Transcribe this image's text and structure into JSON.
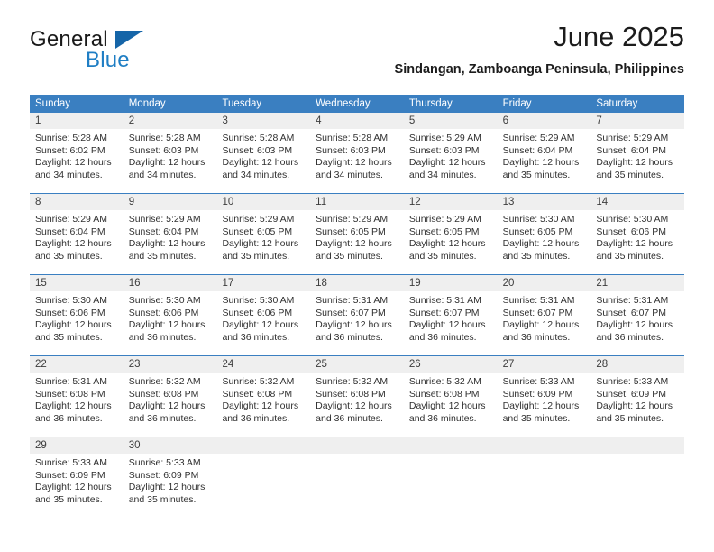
{
  "brand": {
    "name_top": "General",
    "name_bottom": "Blue",
    "triangle_color": "#1565a8",
    "blue_text_color": "#1f7ec4"
  },
  "header": {
    "title": "June 2025",
    "subtitle": "Sindangan, Zamboanga Peninsula, Philippines"
  },
  "colors": {
    "header_band": "#3a7fc1",
    "daynum_band": "#efefef",
    "separator": "#3a7fc1",
    "text": "#303030"
  },
  "weekdays": [
    "Sunday",
    "Monday",
    "Tuesday",
    "Wednesday",
    "Thursday",
    "Friday",
    "Saturday"
  ],
  "weeks": [
    [
      {
        "day": "1",
        "sunrise": "Sunrise: 5:28 AM",
        "sunset": "Sunset: 6:02 PM",
        "daylight_1": "Daylight: 12 hours",
        "daylight_2": "and 34 minutes."
      },
      {
        "day": "2",
        "sunrise": "Sunrise: 5:28 AM",
        "sunset": "Sunset: 6:03 PM",
        "daylight_1": "Daylight: 12 hours",
        "daylight_2": "and 34 minutes."
      },
      {
        "day": "3",
        "sunrise": "Sunrise: 5:28 AM",
        "sunset": "Sunset: 6:03 PM",
        "daylight_1": "Daylight: 12 hours",
        "daylight_2": "and 34 minutes."
      },
      {
        "day": "4",
        "sunrise": "Sunrise: 5:28 AM",
        "sunset": "Sunset: 6:03 PM",
        "daylight_1": "Daylight: 12 hours",
        "daylight_2": "and 34 minutes."
      },
      {
        "day": "5",
        "sunrise": "Sunrise: 5:29 AM",
        "sunset": "Sunset: 6:03 PM",
        "daylight_1": "Daylight: 12 hours",
        "daylight_2": "and 34 minutes."
      },
      {
        "day": "6",
        "sunrise": "Sunrise: 5:29 AM",
        "sunset": "Sunset: 6:04 PM",
        "daylight_1": "Daylight: 12 hours",
        "daylight_2": "and 35 minutes."
      },
      {
        "day": "7",
        "sunrise": "Sunrise: 5:29 AM",
        "sunset": "Sunset: 6:04 PM",
        "daylight_1": "Daylight: 12 hours",
        "daylight_2": "and 35 minutes."
      }
    ],
    [
      {
        "day": "8",
        "sunrise": "Sunrise: 5:29 AM",
        "sunset": "Sunset: 6:04 PM",
        "daylight_1": "Daylight: 12 hours",
        "daylight_2": "and 35 minutes."
      },
      {
        "day": "9",
        "sunrise": "Sunrise: 5:29 AM",
        "sunset": "Sunset: 6:04 PM",
        "daylight_1": "Daylight: 12 hours",
        "daylight_2": "and 35 minutes."
      },
      {
        "day": "10",
        "sunrise": "Sunrise: 5:29 AM",
        "sunset": "Sunset: 6:05 PM",
        "daylight_1": "Daylight: 12 hours",
        "daylight_2": "and 35 minutes."
      },
      {
        "day": "11",
        "sunrise": "Sunrise: 5:29 AM",
        "sunset": "Sunset: 6:05 PM",
        "daylight_1": "Daylight: 12 hours",
        "daylight_2": "and 35 minutes."
      },
      {
        "day": "12",
        "sunrise": "Sunrise: 5:29 AM",
        "sunset": "Sunset: 6:05 PM",
        "daylight_1": "Daylight: 12 hours",
        "daylight_2": "and 35 minutes."
      },
      {
        "day": "13",
        "sunrise": "Sunrise: 5:30 AM",
        "sunset": "Sunset: 6:05 PM",
        "daylight_1": "Daylight: 12 hours",
        "daylight_2": "and 35 minutes."
      },
      {
        "day": "14",
        "sunrise": "Sunrise: 5:30 AM",
        "sunset": "Sunset: 6:06 PM",
        "daylight_1": "Daylight: 12 hours",
        "daylight_2": "and 35 minutes."
      }
    ],
    [
      {
        "day": "15",
        "sunrise": "Sunrise: 5:30 AM",
        "sunset": "Sunset: 6:06 PM",
        "daylight_1": "Daylight: 12 hours",
        "daylight_2": "and 35 minutes."
      },
      {
        "day": "16",
        "sunrise": "Sunrise: 5:30 AM",
        "sunset": "Sunset: 6:06 PM",
        "daylight_1": "Daylight: 12 hours",
        "daylight_2": "and 36 minutes."
      },
      {
        "day": "17",
        "sunrise": "Sunrise: 5:30 AM",
        "sunset": "Sunset: 6:06 PM",
        "daylight_1": "Daylight: 12 hours",
        "daylight_2": "and 36 minutes."
      },
      {
        "day": "18",
        "sunrise": "Sunrise: 5:31 AM",
        "sunset": "Sunset: 6:07 PM",
        "daylight_1": "Daylight: 12 hours",
        "daylight_2": "and 36 minutes."
      },
      {
        "day": "19",
        "sunrise": "Sunrise: 5:31 AM",
        "sunset": "Sunset: 6:07 PM",
        "daylight_1": "Daylight: 12 hours",
        "daylight_2": "and 36 minutes."
      },
      {
        "day": "20",
        "sunrise": "Sunrise: 5:31 AM",
        "sunset": "Sunset: 6:07 PM",
        "daylight_1": "Daylight: 12 hours",
        "daylight_2": "and 36 minutes."
      },
      {
        "day": "21",
        "sunrise": "Sunrise: 5:31 AM",
        "sunset": "Sunset: 6:07 PM",
        "daylight_1": "Daylight: 12 hours",
        "daylight_2": "and 36 minutes."
      }
    ],
    [
      {
        "day": "22",
        "sunrise": "Sunrise: 5:31 AM",
        "sunset": "Sunset: 6:08 PM",
        "daylight_1": "Daylight: 12 hours",
        "daylight_2": "and 36 minutes."
      },
      {
        "day": "23",
        "sunrise": "Sunrise: 5:32 AM",
        "sunset": "Sunset: 6:08 PM",
        "daylight_1": "Daylight: 12 hours",
        "daylight_2": "and 36 minutes."
      },
      {
        "day": "24",
        "sunrise": "Sunrise: 5:32 AM",
        "sunset": "Sunset: 6:08 PM",
        "daylight_1": "Daylight: 12 hours",
        "daylight_2": "and 36 minutes."
      },
      {
        "day": "25",
        "sunrise": "Sunrise: 5:32 AM",
        "sunset": "Sunset: 6:08 PM",
        "daylight_1": "Daylight: 12 hours",
        "daylight_2": "and 36 minutes."
      },
      {
        "day": "26",
        "sunrise": "Sunrise: 5:32 AM",
        "sunset": "Sunset: 6:08 PM",
        "daylight_1": "Daylight: 12 hours",
        "daylight_2": "and 36 minutes."
      },
      {
        "day": "27",
        "sunrise": "Sunrise: 5:33 AM",
        "sunset": "Sunset: 6:09 PM",
        "daylight_1": "Daylight: 12 hours",
        "daylight_2": "and 35 minutes."
      },
      {
        "day": "28",
        "sunrise": "Sunrise: 5:33 AM",
        "sunset": "Sunset: 6:09 PM",
        "daylight_1": "Daylight: 12 hours",
        "daylight_2": "and 35 minutes."
      }
    ],
    [
      {
        "day": "29",
        "sunrise": "Sunrise: 5:33 AM",
        "sunset": "Sunset: 6:09 PM",
        "daylight_1": "Daylight: 12 hours",
        "daylight_2": "and 35 minutes."
      },
      {
        "day": "30",
        "sunrise": "Sunrise: 5:33 AM",
        "sunset": "Sunset: 6:09 PM",
        "daylight_1": "Daylight: 12 hours",
        "daylight_2": "and 35 minutes."
      },
      {
        "day": "",
        "sunrise": "",
        "sunset": "",
        "daylight_1": "",
        "daylight_2": ""
      },
      {
        "day": "",
        "sunrise": "",
        "sunset": "",
        "daylight_1": "",
        "daylight_2": ""
      },
      {
        "day": "",
        "sunrise": "",
        "sunset": "",
        "daylight_1": "",
        "daylight_2": ""
      },
      {
        "day": "",
        "sunrise": "",
        "sunset": "",
        "daylight_1": "",
        "daylight_2": ""
      },
      {
        "day": "",
        "sunrise": "",
        "sunset": "",
        "daylight_1": "",
        "daylight_2": ""
      }
    ]
  ]
}
